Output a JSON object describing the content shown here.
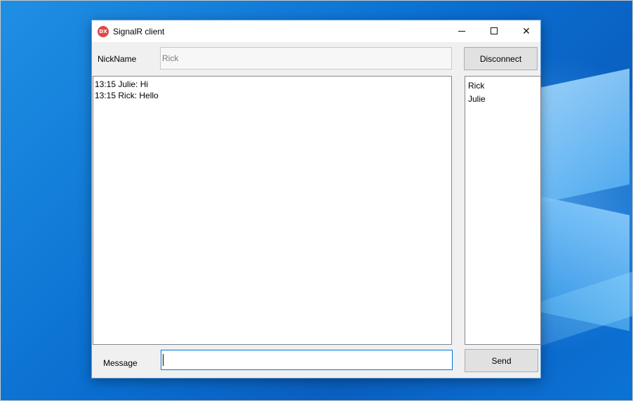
{
  "window": {
    "title": "SignalR client",
    "icon_text": "DX",
    "icon_color": "#e04848"
  },
  "caption_buttons": [
    "minimize",
    "maximize",
    "close"
  ],
  "nickname": {
    "label": "NickName",
    "value": "Rick"
  },
  "disconnect_button": {
    "label": "Disconnect"
  },
  "chat": {
    "messages": [
      "13:15 Julie: Hi",
      "13:15 Rick: Hello"
    ]
  },
  "users": [
    "Rick",
    "Julie"
  ],
  "message": {
    "label": "Message",
    "value": ""
  },
  "send_button": {
    "label": "Send"
  },
  "colors": {
    "accent_focus": "#0078d7",
    "desktop": "#0a6fd1"
  }
}
